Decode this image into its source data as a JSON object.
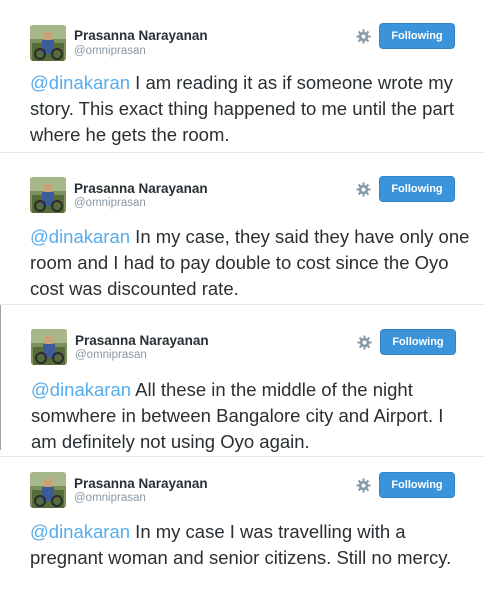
{
  "colors": {
    "accent": "#55acee",
    "follow_button": "#3b94d9",
    "name_text": "#292f33",
    "handle_text": "#8899a6"
  },
  "tweets": [
    {
      "author_name": "Prasanna Narayanan",
      "handle": "@omniprasan",
      "follow_label": "Following",
      "mention": "@dinakaran",
      "body": " I am reading it as if someone wrote my story. This exact thing happened to me until the part where he gets the room.",
      "settings_icon": "gear-icon"
    },
    {
      "author_name": "Prasanna Narayanan",
      "handle": "@omniprasan",
      "follow_label": "Following",
      "mention": "@dinakaran",
      "body": " In my case, they said they have only one room and I had to pay double to cost since the Oyo cost was discounted rate.",
      "settings_icon": "gear-icon"
    },
    {
      "author_name": "Prasanna Narayanan",
      "handle": "@omniprasan",
      "follow_label": "Following",
      "mention": "@dinakaran",
      "body": " All these in the middle of the night somwhere in between Bangalore city and Airport. I am definitely not using Oyo again.",
      "settings_icon": "gear-icon"
    },
    {
      "author_name": "Prasanna Narayanan",
      "handle": "@omniprasan",
      "follow_label": "Following",
      "mention": "@dinakaran",
      "body": " In my case I was travelling with a pregnant woman and senior citizens. Still no mercy.",
      "settings_icon": "gear-icon"
    }
  ]
}
